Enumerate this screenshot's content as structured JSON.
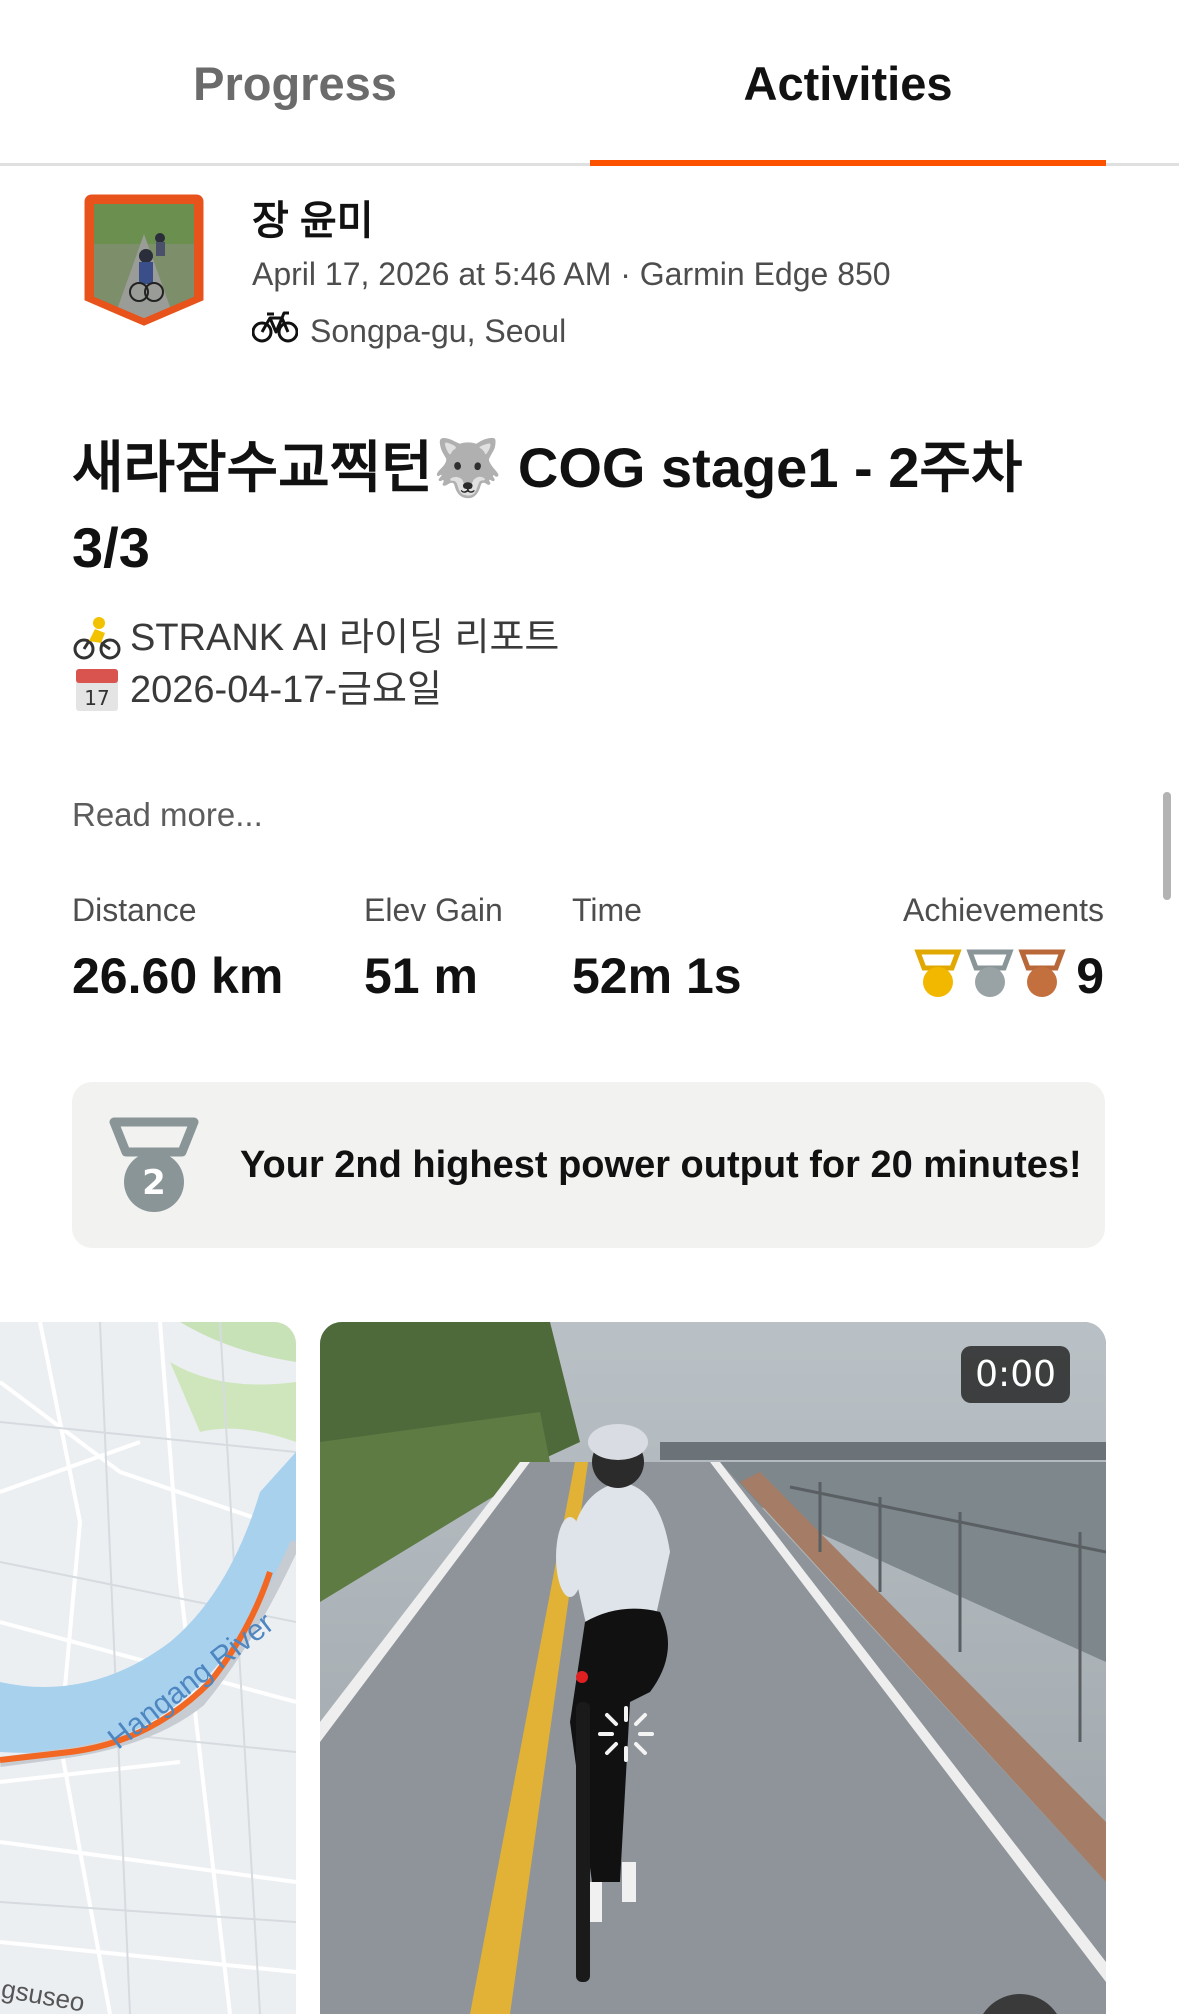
{
  "tabs": [
    {
      "label": "Progress",
      "active": false
    },
    {
      "label": "Activities",
      "active": true
    }
  ],
  "accent_color": "#fc5200",
  "activity": {
    "athlete_name": "장 윤미",
    "meta": "April 17, 2026 at 5:46 AM · Garmin Edge 850",
    "location_icon": "bicycle-icon",
    "location": "Songpa-gu, Seoul",
    "title": "새라잠수교찍턴🐺 COG stage1 - 2주차 3/3",
    "description": [
      {
        "icon": "cyclist-emoji",
        "text": "STRANK AI 라이딩 리포트"
      },
      {
        "icon": "calendar-emoji",
        "text": "2026-04-17-금요일"
      }
    ],
    "read_more": "Read more..."
  },
  "stats": {
    "distance_label": "Distance",
    "distance_value": "26.60 km",
    "elev_label": "Elev Gain",
    "elev_value": "51 m",
    "time_label": "Time",
    "time_value": "52m 1s",
    "achievements_label": "Achievements",
    "achievements_count": "9",
    "medal_icons": [
      "gold-medal-icon",
      "silver-medal-icon",
      "bronze-medal-icon"
    ]
  },
  "achievement_banner": {
    "icon": "second-place-medal-icon",
    "medal_number": "2",
    "text": "Your 2nd highest power output for 20 minutes!"
  },
  "media": {
    "map_river_label": "Hangang River",
    "map_partial_label": "gsuseo",
    "video_timestamp": "0:00"
  }
}
